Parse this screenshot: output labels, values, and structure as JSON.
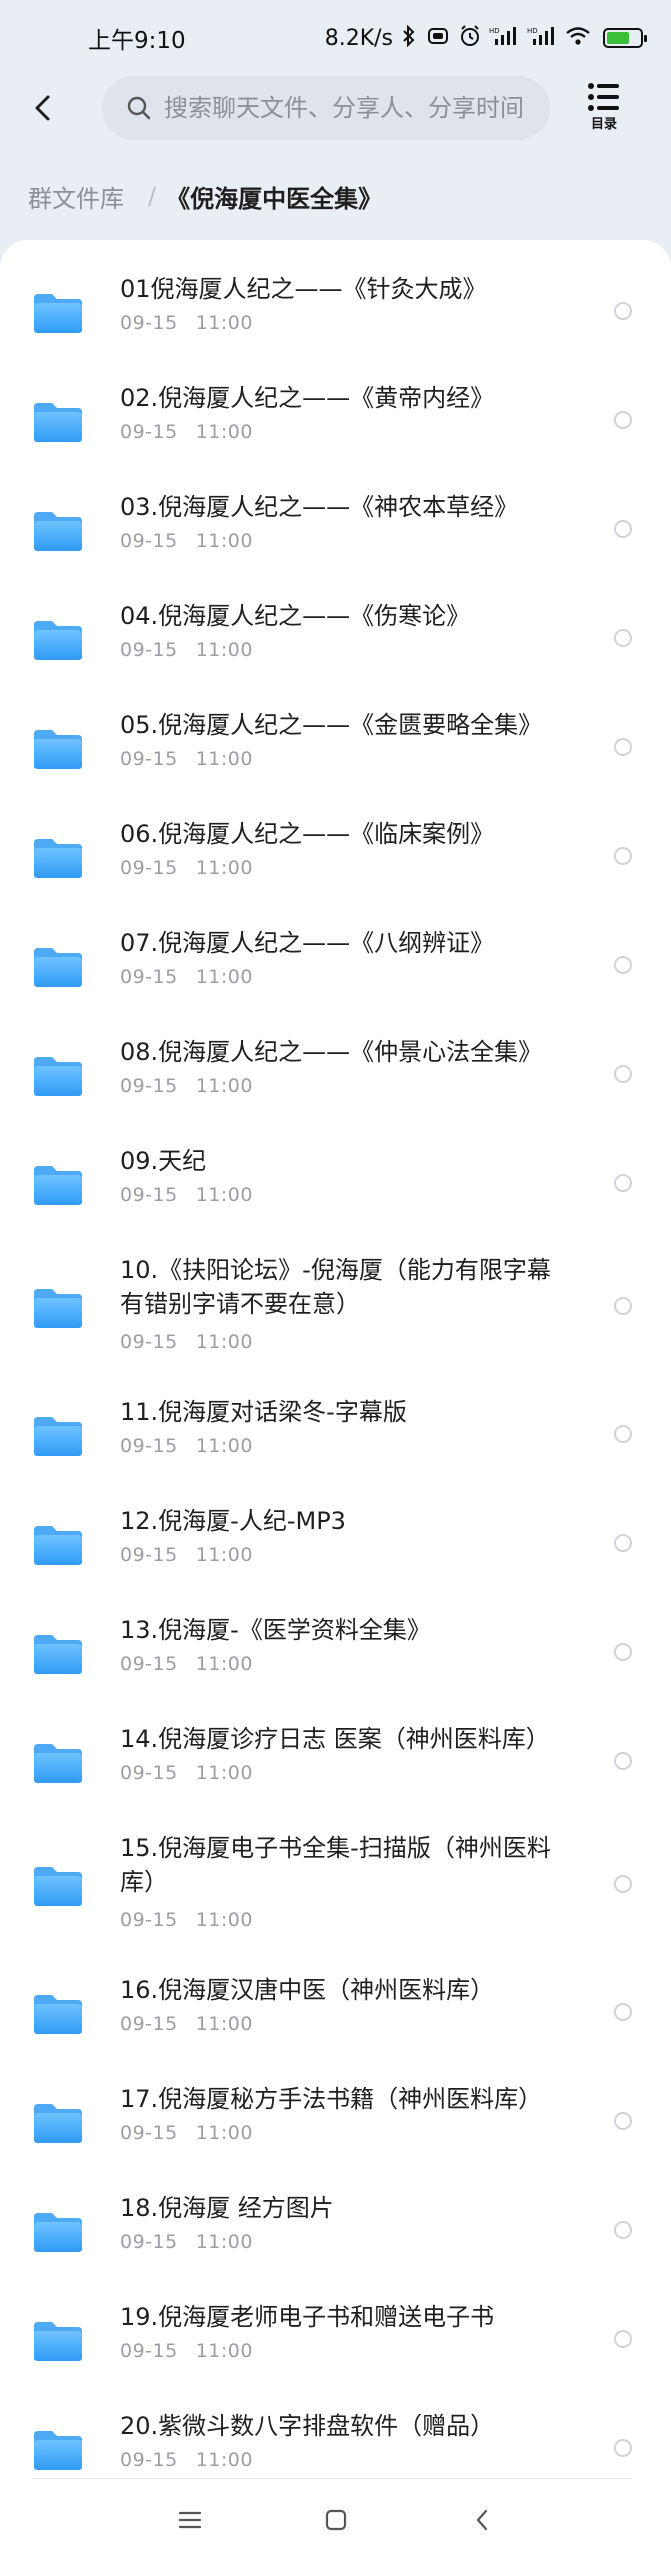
{
  "status": {
    "time": "上午9:10",
    "speed": "8.2K/s",
    "battery_color": "#3bbf3b"
  },
  "header": {
    "search_placeholder": "搜索聊天文件、分享人、分享时间",
    "menu_label": "目录"
  },
  "breadcrumb": {
    "root": "群文件库",
    "separator": "/",
    "current": "《倪海厦中医全集》"
  },
  "colors": {
    "folder_top": "#6fc3ff",
    "folder_bottom": "#2f9bf3",
    "accent": "#2f9bf3"
  },
  "items": [
    {
      "title": "01倪海厦人纪之——《针灸大成》",
      "date": "09-15",
      "time": "11:00"
    },
    {
      "title": "02.倪海厦人纪之——《黄帝内经》",
      "date": "09-15",
      "time": "11:00"
    },
    {
      "title": "03.倪海厦人纪之——《神农本草经》",
      "date": "09-15",
      "time": "11:00"
    },
    {
      "title": "04.倪海厦人纪之——《伤寒论》",
      "date": "09-15",
      "time": "11:00"
    },
    {
      "title": "05.倪海厦人纪之——《金匮要略全集》",
      "date": "09-15",
      "time": "11:00"
    },
    {
      "title": "06.倪海厦人纪之——《临床案例》",
      "date": "09-15",
      "time": "11:00"
    },
    {
      "title": "07.倪海厦人纪之——《八纲辨证》",
      "date": "09-15",
      "time": "11:00"
    },
    {
      "title": "08.倪海厦人纪之——《仲景心法全集》",
      "date": "09-15",
      "time": "11:00"
    },
    {
      "title": "09.天纪",
      "date": "09-15",
      "time": "11:00"
    },
    {
      "title": "10.《扶阳论坛》-倪海厦（能力有限字幕有错别字请不要在意）",
      "date": "09-15",
      "time": "11:00"
    },
    {
      "title": "11.倪海厦对话梁冬-字幕版",
      "date": "09-15",
      "time": "11:00"
    },
    {
      "title": "12.倪海厦-人纪-MP3",
      "date": "09-15",
      "time": "11:00"
    },
    {
      "title": "13.倪海厦-《医学资料全集》",
      "date": "09-15",
      "time": "11:00"
    },
    {
      "title": "14.倪海厦诊疗日志 医案（神州医料库）",
      "date": "09-15",
      "time": "11:00"
    },
    {
      "title": "15.倪海厦电子书全集-扫描版（神州医料库）",
      "date": "09-15",
      "time": "11:00"
    },
    {
      "title": "16.倪海厦汉唐中医（神州医料库）",
      "date": "09-15",
      "time": "11:00"
    },
    {
      "title": "17.倪海厦秘方手法书籍（神州医料库）",
      "date": "09-15",
      "time": "11:00"
    },
    {
      "title": "18.倪海厦 经方图片",
      "date": "09-15",
      "time": "11:00"
    },
    {
      "title": "19.倪海厦老师电子书和赠送电子书",
      "date": "09-15",
      "time": "11:00"
    },
    {
      "title": "20.紫微斗数八字排盘软件（赠品）",
      "date": "09-15",
      "time": "11:00"
    }
  ]
}
